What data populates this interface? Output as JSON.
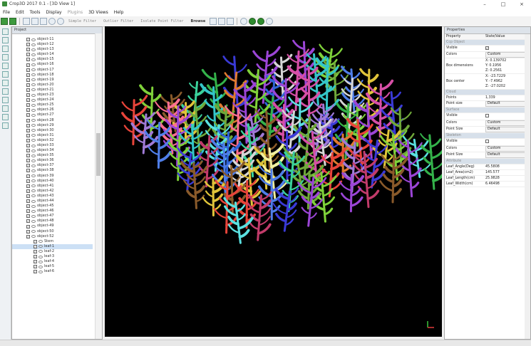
{
  "window": {
    "title": "Crop3D 2017 0.1 - [3D View 1]",
    "controls": [
      "–",
      "□",
      "×"
    ]
  },
  "menu": [
    {
      "label": "File",
      "enabled": true
    },
    {
      "label": "Edit",
      "enabled": true
    },
    {
      "label": "Tools",
      "enabled": true
    },
    {
      "label": "Display",
      "enabled": true
    },
    {
      "label": "Plugins",
      "enabled": false
    },
    {
      "label": "3D Views",
      "enabled": true
    },
    {
      "label": "Help",
      "enabled": true
    }
  ],
  "toolbar": {
    "filters": [
      "Simple Filter",
      "Outlier Filter",
      "Isolate Point Filter"
    ],
    "browse_label": "Browse"
  },
  "project": {
    "header": "Project",
    "objects": [
      "object-11",
      "object-12",
      "object-13",
      "object-14",
      "object-15",
      "object-16",
      "object-17",
      "object-18",
      "object-19",
      "object-20",
      "object-21",
      "object-23",
      "object-24",
      "object-25",
      "object-26",
      "object-27",
      "object-28",
      "object-29",
      "object-30",
      "object-31",
      "object-32",
      "object-33",
      "object-34",
      "object-35",
      "object-36",
      "object-37",
      "object-38",
      "object-39",
      "object-40",
      "object-41",
      "object-42",
      "object-43",
      "object-44",
      "object-45",
      "object-46",
      "object-47",
      "object-48",
      "object-49",
      "object-50",
      "object-52"
    ],
    "children": [
      "Stem",
      "leaf-1",
      "leaf-2",
      "leaf-3",
      "leaf-4",
      "leaf-5",
      "leaf-6"
    ],
    "selected_child": "leaf-1"
  },
  "properties": {
    "header": "Properties",
    "col_property": "Property",
    "col_value": "State/Value",
    "rows": [
      {
        "type": "section",
        "label": "Ccp Object"
      },
      {
        "type": "check",
        "key": "Visible",
        "checked": true
      },
      {
        "type": "select",
        "key": "Colors",
        "value": "Custom"
      },
      {
        "type": "multi",
        "key": "Box dimensions",
        "values": [
          "X: 0.139702",
          "Y: 0.1956",
          "Z: 0.2561"
        ]
      },
      {
        "type": "multi",
        "key": "Box center",
        "values": [
          "X: -23.7229",
          "Y: -7.4962",
          "Z: -27.0202"
        ]
      },
      {
        "type": "section",
        "label": "Cloud"
      },
      {
        "type": "text",
        "key": "Points",
        "value": "1,339"
      },
      {
        "type": "select",
        "key": "Point size",
        "value": "Default"
      },
      {
        "type": "section",
        "label": "Surface"
      },
      {
        "type": "check",
        "key": "Visible",
        "checked": false
      },
      {
        "type": "select",
        "key": "Colors",
        "value": "Custom"
      },
      {
        "type": "select",
        "key": "Point Size",
        "value": "Default"
      },
      {
        "type": "section",
        "label": "Skeleton"
      },
      {
        "type": "check",
        "key": "Visible",
        "checked": false
      },
      {
        "type": "select",
        "key": "Colors",
        "value": "Custom"
      },
      {
        "type": "select",
        "key": "Point Size",
        "value": "Default"
      },
      {
        "type": "section",
        "label": "Attribute"
      },
      {
        "type": "text",
        "key": "Leaf_Angle(Deg)",
        "value": "45.5808"
      },
      {
        "type": "text",
        "key": "Leaf_Area(cm2)",
        "value": "145.577"
      },
      {
        "type": "text",
        "key": "Leaf_Length(cm)",
        "value": "25.9828"
      },
      {
        "type": "text",
        "key": "Leaf_Width(cm)",
        "value": "6.46498"
      }
    ]
  },
  "colors": {
    "viewport_bg": "#000000",
    "plant_palette": [
      "#e8443a",
      "#34b24a",
      "#2f63d8",
      "#e0c43a",
      "#9b45d6",
      "#34c6c9",
      "#e07a2f",
      "#d64fa6",
      "#7fd13a",
      "#4f7ee8",
      "#c23b6a",
      "#f0f0a0",
      "#3ad19b",
      "#a07ad6",
      "#8a5a2a",
      "#5ae0e0",
      "#d6d6d6",
      "#ff6f91",
      "#6fa83a",
      "#3a3ad6"
    ]
  }
}
